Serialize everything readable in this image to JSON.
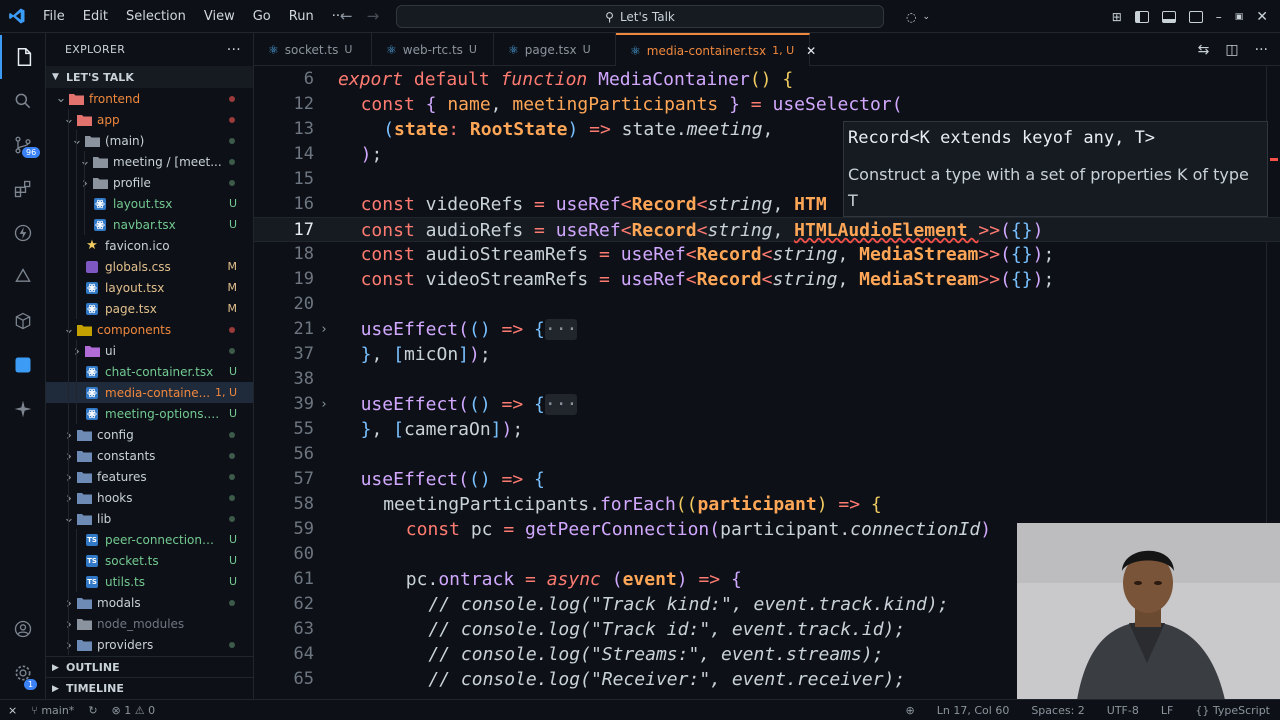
{
  "titlebar": {
    "menu": [
      "File",
      "Edit",
      "Selection",
      "View",
      "Go",
      "Run",
      "···"
    ],
    "search": "Let's Talk"
  },
  "sidebar": {
    "title": "EXPLORER",
    "more": "···",
    "root": "LET'S TALK",
    "items": [
      {
        "name": "frontend",
        "depth": 0,
        "kind": "folder-open",
        "color": "#f0883e",
        "status": "dot-red"
      },
      {
        "name": "app",
        "depth": 1,
        "kind": "folder-open",
        "color": "#f0883e",
        "status": "dot-red"
      },
      {
        "name": "(main)",
        "depth": 2,
        "kind": "folder-open",
        "color": "#c9d1d9",
        "status": "dot-gray"
      },
      {
        "name": "meeting / [meet...",
        "depth": 3,
        "kind": "folder-open",
        "color": "#c9d1d9",
        "status": "dot-gray"
      },
      {
        "name": "profile",
        "depth": 3,
        "kind": "folder",
        "color": "#c9d1d9",
        "status": "dot-gray"
      },
      {
        "name": "layout.tsx",
        "depth": 3,
        "kind": "tsx",
        "color": "#c9d1d9",
        "status": "U"
      },
      {
        "name": "navbar.tsx",
        "depth": 3,
        "kind": "tsx",
        "color": "#c9d1d9",
        "status": "U"
      },
      {
        "name": "favicon.ico",
        "depth": 2,
        "kind": "star",
        "color": "#c9d1d9",
        "status": ""
      },
      {
        "name": "globals.css",
        "depth": 2,
        "kind": "css",
        "color": "#c9d1d9",
        "status": "M"
      },
      {
        "name": "layout.tsx",
        "depth": 2,
        "kind": "tsx",
        "color": "#c9d1d9",
        "status": "M"
      },
      {
        "name": "page.tsx",
        "depth": 2,
        "kind": "tsx",
        "color": "#c9d1d9",
        "status": "M"
      },
      {
        "name": "components",
        "depth": 1,
        "kind": "folder-open",
        "color": "#f0883e",
        "status": "dot-red"
      },
      {
        "name": "ui",
        "depth": 2,
        "kind": "folder",
        "color": "#c9d1d9",
        "status": "dot-gray"
      },
      {
        "name": "chat-container.tsx",
        "depth": 2,
        "kind": "tsx",
        "color": "#c9d1d9",
        "status": "U"
      },
      {
        "name": "media-containe...",
        "depth": 2,
        "kind": "tsx",
        "color": "#f0883e",
        "status": "1, U",
        "selected": true
      },
      {
        "name": "meeting-options.tsx",
        "depth": 2,
        "kind": "tsx",
        "color": "#c9d1d9",
        "status": "U"
      },
      {
        "name": "config",
        "depth": 1,
        "kind": "folder",
        "color": "#c9d1d9",
        "status": "dot-gray"
      },
      {
        "name": "constants",
        "depth": 1,
        "kind": "folder",
        "color": "#c9d1d9",
        "status": "dot-gray"
      },
      {
        "name": "features",
        "depth": 1,
        "kind": "folder",
        "color": "#c9d1d9",
        "status": "dot-gray"
      },
      {
        "name": "hooks",
        "depth": 1,
        "kind": "folder",
        "color": "#c9d1d9",
        "status": "dot-gray"
      },
      {
        "name": "lib",
        "depth": 1,
        "kind": "folder-open",
        "color": "#c9d1d9",
        "status": "dot-gray"
      },
      {
        "name": "peer-connections.ts",
        "depth": 2,
        "kind": "ts",
        "color": "#c9d1d9",
        "status": "U"
      },
      {
        "name": "socket.ts",
        "depth": 2,
        "kind": "ts",
        "color": "#c9d1d9",
        "status": "U"
      },
      {
        "name": "utils.ts",
        "depth": 2,
        "kind": "ts",
        "color": "#c9d1d9",
        "status": "U"
      },
      {
        "name": "modals",
        "depth": 1,
        "kind": "folder",
        "color": "#c9d1d9",
        "status": "dot-gray"
      },
      {
        "name": "node_modules",
        "depth": 1,
        "kind": "folder",
        "color": "#8b949e",
        "status": ""
      },
      {
        "name": "providers",
        "depth": 1,
        "kind": "folder",
        "color": "#c9d1d9",
        "status": "dot-gray"
      }
    ],
    "outline": "OUTLINE",
    "timeline": "TIMELINE"
  },
  "tabs": [
    {
      "name": "socket.ts",
      "status": "U",
      "active": false
    },
    {
      "name": "web-rtc.ts",
      "status": "U",
      "active": false
    },
    {
      "name": "page.tsx",
      "status": "U",
      "active": false
    },
    {
      "name": "media-container.tsx",
      "status": "1, U",
      "active": true
    }
  ],
  "hover": {
    "signature": "Record<K extends keyof any, T>",
    "description": "Construct a type with a set of properties K of type T"
  },
  "status": {
    "branch": "main*",
    "problems": "⊗ 1 ⚠ 0",
    "position": "Ln 17, Col 60",
    "spaces": "Spaces: 2",
    "encoding": "UTF-8",
    "eol": "LF",
    "language": "TypeScript"
  },
  "editor": {
    "lines": [
      {
        "n": "6",
        "segs": [
          [
            "kw",
            "export "
          ],
          [
            "kw2",
            "default "
          ],
          [
            "kw",
            "function "
          ],
          [
            "fn",
            "MediaContainer"
          ],
          [
            "br1",
            "() {"
          ]
        ],
        "indent": 0
      },
      {
        "n": "12",
        "segs": [
          [
            "kw2",
            "const "
          ],
          [
            "br2",
            "{ "
          ],
          [
            "var",
            "name"
          ],
          [
            "pu",
            ", "
          ],
          [
            "var",
            "meetingParticipants "
          ],
          [
            "br2",
            "} "
          ],
          [
            "op",
            "= "
          ],
          [
            "fn",
            "useSelector"
          ],
          [
            "br2",
            "("
          ]
        ],
        "indent": 1
      },
      {
        "n": "13",
        "segs": [
          [
            "br3",
            "("
          ],
          [
            "ty",
            "state"
          ],
          [
            "op",
            ": "
          ],
          [
            "ty",
            "RootState"
          ],
          [
            "br3",
            ") "
          ],
          [
            "op",
            "=> "
          ],
          [
            "id",
            "state."
          ],
          [
            "prop",
            "meeting"
          ],
          [
            "pu",
            ","
          ]
        ],
        "indent": 2
      },
      {
        "n": "14",
        "segs": [
          [
            "br2",
            ")"
          ],
          [
            "pu",
            ";"
          ]
        ],
        "indent": 1
      },
      {
        "n": "15",
        "segs": [],
        "indent": 0
      },
      {
        "n": "16",
        "segs": [
          [
            "kw2",
            "const "
          ],
          [
            "id",
            "videoRefs "
          ],
          [
            "op",
            "= "
          ],
          [
            "fn",
            "useRef"
          ],
          [
            "op",
            "<"
          ],
          [
            "ty",
            "Record"
          ],
          [
            "op",
            "<"
          ],
          [
            "tyi",
            "string"
          ],
          [
            "pu",
            ", "
          ],
          [
            "ty",
            "HTM"
          ]
        ],
        "indent": 1
      },
      {
        "n": "17",
        "segs": [
          [
            "kw2",
            "const "
          ],
          [
            "id",
            "audioRefs "
          ],
          [
            "op",
            "= "
          ],
          [
            "fn",
            "useRef"
          ],
          [
            "op",
            "<"
          ],
          [
            "ty",
            "Record"
          ],
          [
            "op",
            "<"
          ],
          [
            "tyi",
            "string"
          ],
          [
            "pu",
            ", "
          ],
          [
            "tysq",
            "HTMLAudioElement "
          ],
          [
            "op",
            ">>"
          ],
          [
            "br2",
            "("
          ],
          [
            "br3",
            "{}"
          ],
          [
            "br2",
            ")"
          ]
        ],
        "indent": 1,
        "cur": true
      },
      {
        "n": "18",
        "segs": [
          [
            "kw2",
            "const "
          ],
          [
            "id",
            "audioStreamRefs "
          ],
          [
            "op",
            "= "
          ],
          [
            "fn",
            "useRef"
          ],
          [
            "op",
            "<"
          ],
          [
            "ty",
            "Record"
          ],
          [
            "op",
            "<"
          ],
          [
            "tyi",
            "string"
          ],
          [
            "pu",
            ", "
          ],
          [
            "ty",
            "MediaStream"
          ],
          [
            "op",
            ">>"
          ],
          [
            "br2",
            "("
          ],
          [
            "br3",
            "{}"
          ],
          [
            "br2",
            ")"
          ],
          [
            "pu",
            ";"
          ]
        ],
        "indent": 1
      },
      {
        "n": "19",
        "segs": [
          [
            "kw2",
            "const "
          ],
          [
            "id",
            "videoStreamRefs "
          ],
          [
            "op",
            "= "
          ],
          [
            "fn",
            "useRef"
          ],
          [
            "op",
            "<"
          ],
          [
            "ty",
            "Record"
          ],
          [
            "op",
            "<"
          ],
          [
            "tyi",
            "string"
          ],
          [
            "pu",
            ", "
          ],
          [
            "ty",
            "MediaStream"
          ],
          [
            "op",
            ">>"
          ],
          [
            "br2",
            "("
          ],
          [
            "br3",
            "{}"
          ],
          [
            "br2",
            ")"
          ],
          [
            "pu",
            ";"
          ]
        ],
        "indent": 1
      },
      {
        "n": "20",
        "segs": [],
        "indent": 0
      },
      {
        "n": "21",
        "segs": [
          [
            "fn",
            "useEffect"
          ],
          [
            "br2",
            "("
          ],
          [
            "br3",
            "() "
          ],
          [
            "op",
            "=> "
          ],
          [
            "br3",
            "{"
          ],
          [
            "fld",
            "···"
          ]
        ],
        "indent": 1,
        "fold": true
      },
      {
        "n": "37",
        "segs": [
          [
            "br3",
            "}"
          ],
          [
            "pu",
            ", "
          ],
          [
            "br3",
            "["
          ],
          [
            "id",
            "micOn"
          ],
          [
            "br3",
            "]"
          ],
          [
            "br2",
            ")"
          ],
          [
            "pu",
            ";"
          ]
        ],
        "indent": 1
      },
      {
        "n": "38",
        "segs": [],
        "indent": 0
      },
      {
        "n": "39",
        "segs": [
          [
            "fn",
            "useEffect"
          ],
          [
            "br2",
            "("
          ],
          [
            "br3",
            "() "
          ],
          [
            "op",
            "=> "
          ],
          [
            "br3",
            "{"
          ],
          [
            "fld",
            "···"
          ]
        ],
        "indent": 1,
        "fold": true
      },
      {
        "n": "55",
        "segs": [
          [
            "br3",
            "}"
          ],
          [
            "pu",
            ", "
          ],
          [
            "br3",
            "["
          ],
          [
            "id",
            "cameraOn"
          ],
          [
            "br3",
            "]"
          ],
          [
            "br2",
            ")"
          ],
          [
            "pu",
            ";"
          ]
        ],
        "indent": 1
      },
      {
        "n": "56",
        "segs": [],
        "indent": 0
      },
      {
        "n": "57",
        "segs": [
          [
            "fn",
            "useEffect"
          ],
          [
            "br2",
            "("
          ],
          [
            "br3",
            "() "
          ],
          [
            "op",
            "=> "
          ],
          [
            "br3",
            "{"
          ]
        ],
        "indent": 1
      },
      {
        "n": "58",
        "segs": [
          [
            "id",
            "meetingParticipants."
          ],
          [
            "fn",
            "forEach"
          ],
          [
            "br1",
            "(("
          ],
          [
            "ty",
            "participant"
          ],
          [
            "br1",
            ") "
          ],
          [
            "op",
            "=> "
          ],
          [
            "br1",
            "{"
          ]
        ],
        "indent": 2
      },
      {
        "n": "59",
        "segs": [
          [
            "kw2",
            "const "
          ],
          [
            "id",
            "pc "
          ],
          [
            "op",
            "= "
          ],
          [
            "fn",
            "getPeerConnection"
          ],
          [
            "br2",
            "("
          ],
          [
            "id",
            "participant."
          ],
          [
            "prop",
            "connectionId"
          ],
          [
            "br2",
            ")"
          ]
        ],
        "indent": 3
      },
      {
        "n": "60",
        "segs": [],
        "indent": 0
      },
      {
        "n": "61",
        "segs": [
          [
            "id",
            "pc."
          ],
          [
            "fn",
            "ontrack "
          ],
          [
            "op",
            "= "
          ],
          [
            "kw",
            "async "
          ],
          [
            "br2",
            "("
          ],
          [
            "ty",
            "event"
          ],
          [
            "br2",
            ") "
          ],
          [
            "op",
            "=> "
          ],
          [
            "br2",
            "{"
          ]
        ],
        "indent": 3
      },
      {
        "n": "62",
        "segs": [
          [
            "cm",
            "// console.log(\"Track kind:\", event.track.kind);"
          ]
        ],
        "indent": 4
      },
      {
        "n": "63",
        "segs": [
          [
            "cm",
            "// console.log(\"Track id:\", event.track.id);"
          ]
        ],
        "indent": 4
      },
      {
        "n": "64",
        "segs": [
          [
            "cm",
            "// console.log(\"Streams:\", event.streams);"
          ]
        ],
        "indent": 4
      },
      {
        "n": "65",
        "segs": [
          [
            "cm",
            "// console.log(\"Receiver:\", event.receiver);"
          ]
        ],
        "indent": 4
      }
    ]
  },
  "colors": {
    "accent": "#3b9bf5",
    "modified": "#f0883e",
    "untracked": "#73c991",
    "error": "#f85149"
  }
}
